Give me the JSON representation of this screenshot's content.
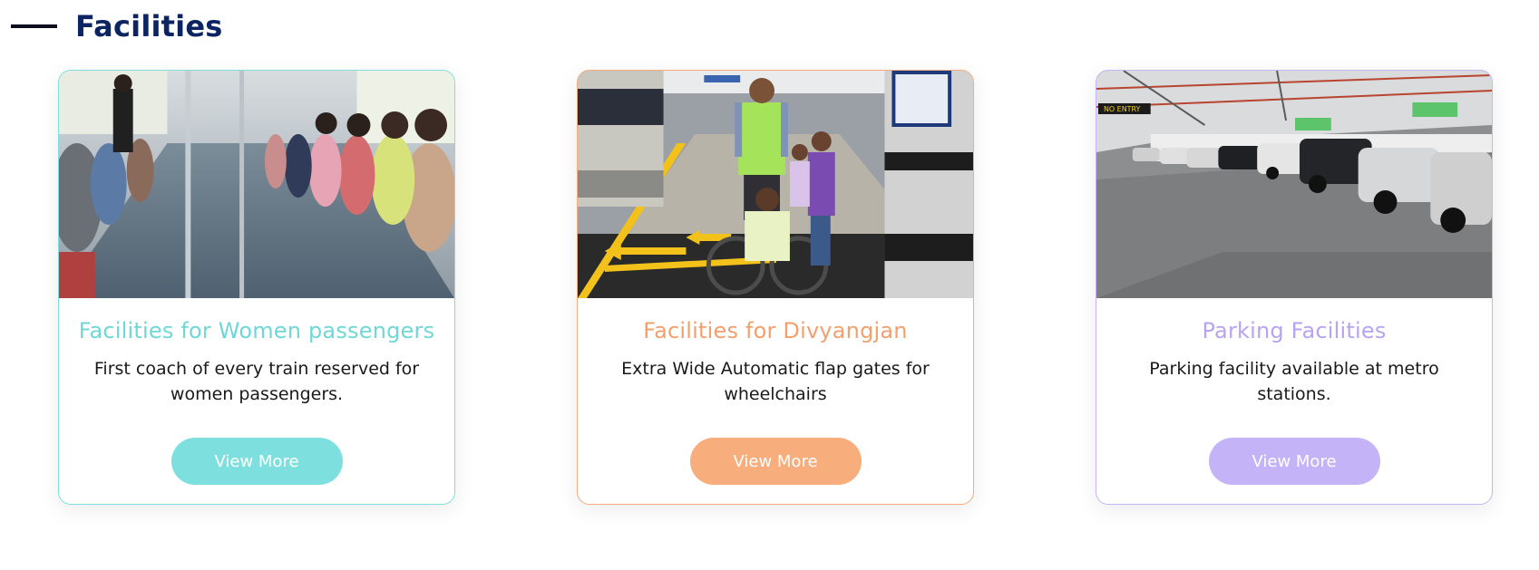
{
  "section": {
    "title": "Facilities"
  },
  "cards": [
    {
      "title": "Facilities for Women passengers",
      "description": "First coach of every train reserved for women passengers.",
      "button_label": "View More",
      "accent_color": "#6fd8d6",
      "button_color": "#7ee0de"
    },
    {
      "title": "Facilities for Divyangjan",
      "description": "Extra Wide Automatic flap gates for wheelchairs",
      "button_label": "View More",
      "accent_color": "#f3a06d",
      "button_color": "#f7ad7c"
    },
    {
      "title": "Parking Facilities",
      "description": "Parking facility available at metro stations.",
      "button_label": "View More",
      "accent_color": "#b8a4f2",
      "button_color": "#c5b3f7"
    }
  ],
  "images": {
    "parking_sign_text": "NO ENTRY"
  }
}
